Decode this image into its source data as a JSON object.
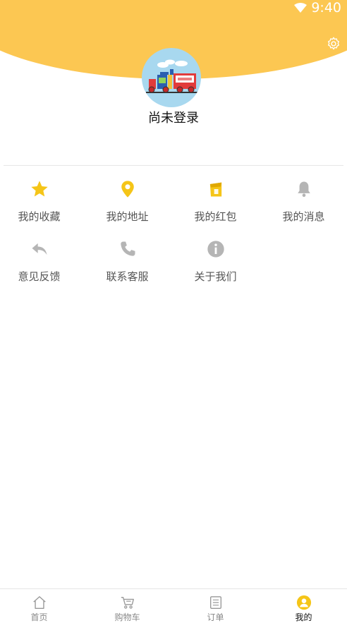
{
  "status_bar": {
    "time": "9:40"
  },
  "profile": {
    "username": "尚未登录"
  },
  "menu": [
    {
      "label": "我的收藏",
      "icon": "star-icon"
    },
    {
      "label": "我的地址",
      "icon": "location-pin-icon"
    },
    {
      "label": "我的红包",
      "icon": "red-packet-icon"
    },
    {
      "label": "我的消息",
      "icon": "bell-icon"
    },
    {
      "label": "意见反馈",
      "icon": "reply-arrow-icon"
    },
    {
      "label": "联系客服",
      "icon": "phone-icon"
    },
    {
      "label": "关于我们",
      "icon": "info-icon"
    }
  ],
  "tabs": [
    {
      "label": "首页",
      "icon": "home-icon"
    },
    {
      "label": "购物车",
      "icon": "cart-icon"
    },
    {
      "label": "订单",
      "icon": "order-list-icon"
    },
    {
      "label": "我的",
      "icon": "profile-icon",
      "active": true
    }
  ],
  "colors": {
    "brand": "#fcc752",
    "icon_yellow": "#f5c518",
    "icon_gray": "#b5b5b5"
  }
}
